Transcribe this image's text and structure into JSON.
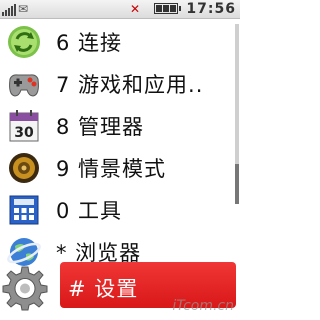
{
  "status_bar": {
    "time": "17:56",
    "signal_bars": 4,
    "battery_level": 1.0,
    "icons": [
      "signal-icon",
      "message-icon",
      "mute-icon",
      "battery-icon"
    ]
  },
  "menu": {
    "items": [
      {
        "key": "6",
        "label": "6 连接",
        "icon": "connectivity-icon"
      },
      {
        "key": "7",
        "label": "7 游戏和应用..",
        "icon": "gamepad-icon"
      },
      {
        "key": "8",
        "label": "8 管理器",
        "icon": "calendar-icon"
      },
      {
        "key": "9",
        "label": "9 情景模式",
        "icon": "speaker-icon"
      },
      {
        "key": "0",
        "label": "0 工具",
        "icon": "calculator-icon"
      },
      {
        "key": "*",
        "label": "* 浏览器",
        "icon": "globe-icon"
      },
      {
        "key": "#",
        "label": "# 设置",
        "icon": "gear-icon",
        "selected": true
      }
    ],
    "selected_index": 6
  },
  "calendar_day": "30",
  "watermark": "iTcom.cn",
  "colors": {
    "selection": "#e02222",
    "text": "#111111",
    "selected_text": "#ffffff"
  }
}
